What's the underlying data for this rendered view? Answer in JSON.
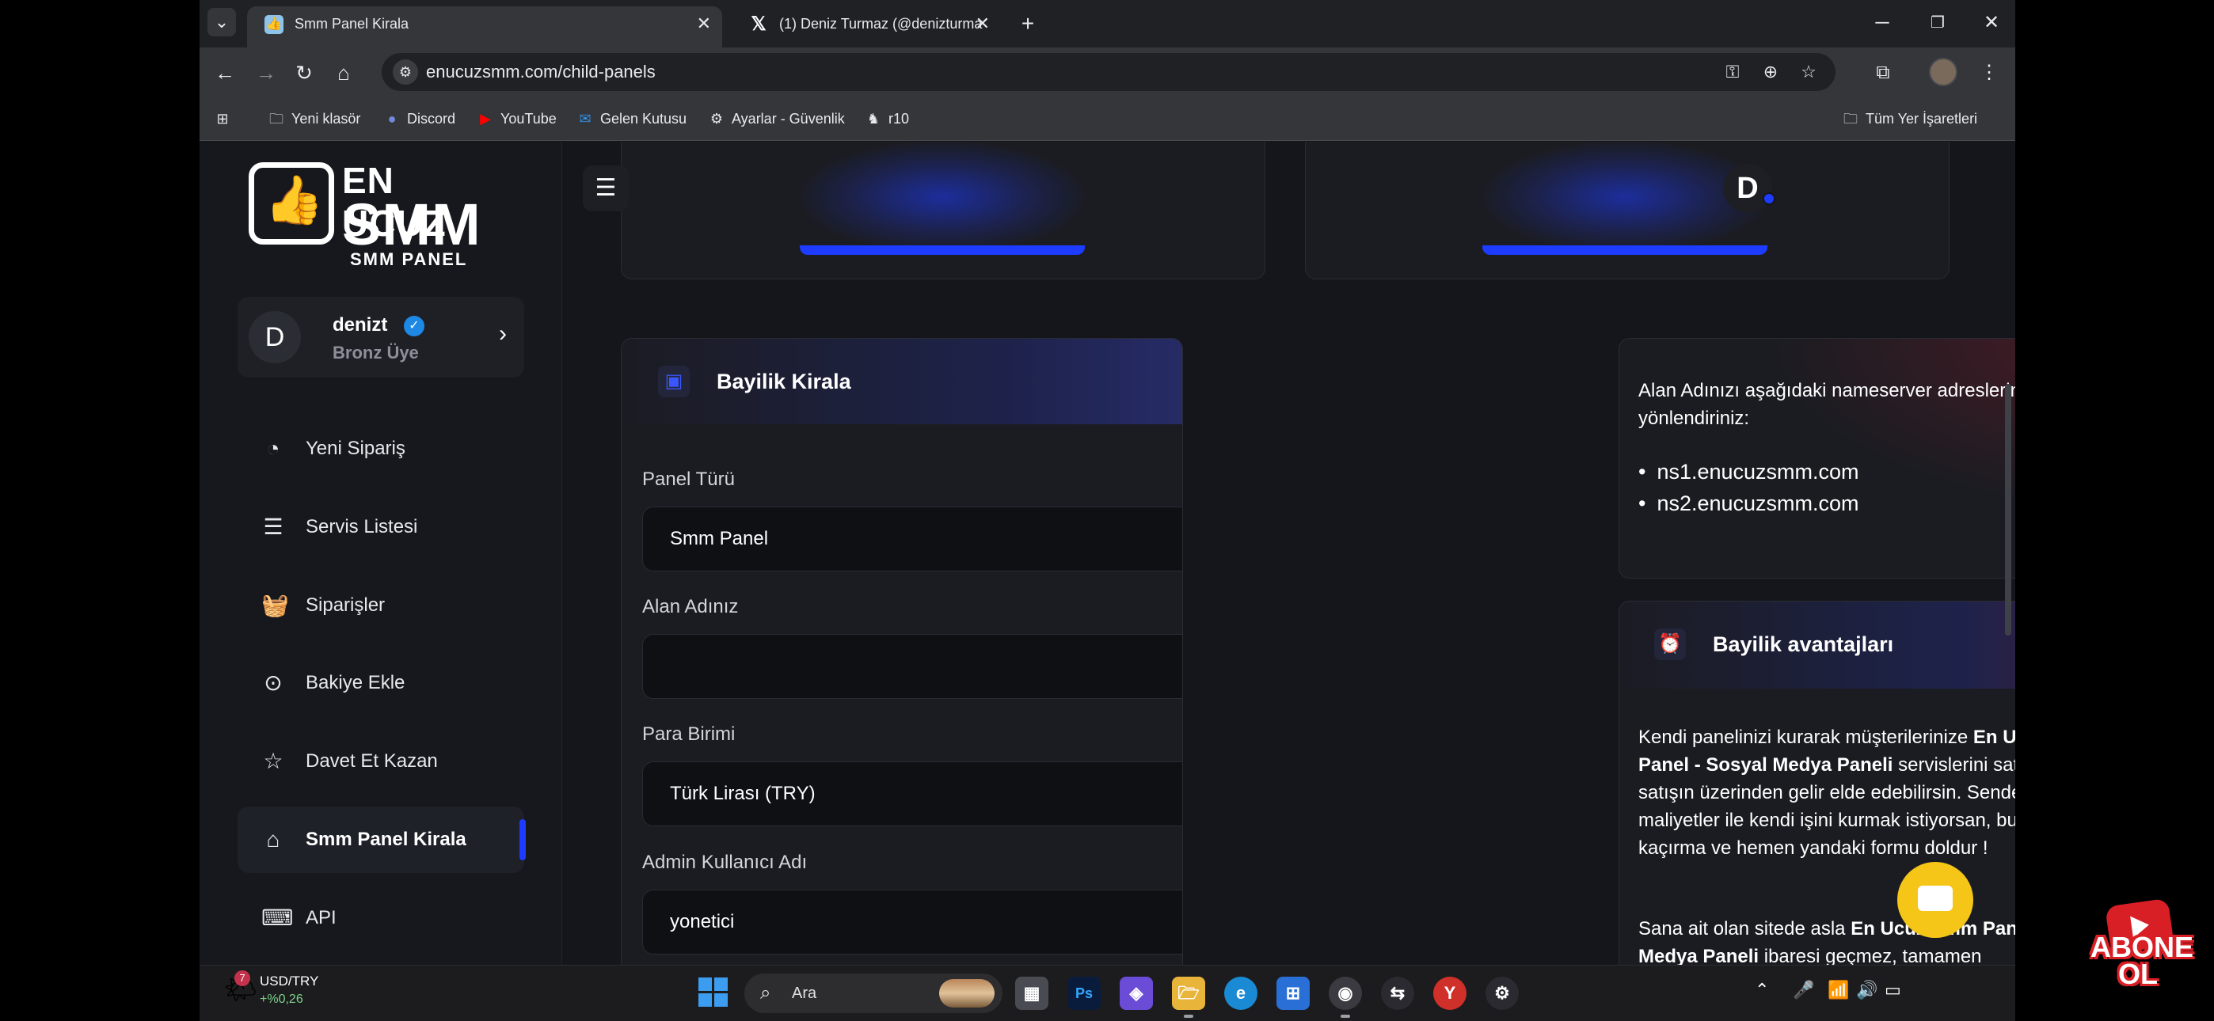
{
  "browser": {
    "tabs": [
      {
        "title": "Smm Panel Kirala",
        "favicon": "smm-favicon",
        "active": true
      },
      {
        "title": "(1) Deniz Turmaz (@denizturma",
        "favicon": "x-logo",
        "active": false
      }
    ],
    "url": "enucuzsmm.com/child-panels",
    "bookmarks": [
      {
        "label": "Yeni klasör",
        "icon": "folder-icon"
      },
      {
        "label": "Discord",
        "icon": "discord-icon"
      },
      {
        "label": "YouTube",
        "icon": "youtube-icon"
      },
      {
        "label": "Gelen Kutusu",
        "icon": "mail-icon"
      },
      {
        "label": "Ayarlar - Güvenlik",
        "icon": "gear-icon"
      },
      {
        "label": "r10",
        "icon": "r10-icon"
      }
    ],
    "all_bookmarks_label": "Tüm Yer İşaretleri"
  },
  "sidebar": {
    "logo": {
      "line1": "EN UCUZ",
      "line2": "SMM",
      "line3": "SMM PANEL"
    },
    "user": {
      "initial": "D",
      "name": "denizt",
      "rank": "Bronz Üye"
    },
    "items": [
      {
        "label": "Yeni Sipariş",
        "icon": "gauge-icon"
      },
      {
        "label": "Servis Listesi",
        "icon": "list-icon"
      },
      {
        "label": "Siparişler",
        "icon": "basket-icon"
      },
      {
        "label": "Bakiye Ekle",
        "icon": "money-icon"
      },
      {
        "label": "Davet Et Kazan",
        "icon": "star-icon"
      },
      {
        "label": "Smm Panel Kirala",
        "icon": "store-icon",
        "active": true
      },
      {
        "label": "API",
        "icon": "terminal-icon"
      }
    ]
  },
  "header": {
    "avatar_initial": "D"
  },
  "form": {
    "title": "Bayilik Kirala",
    "panel_type_label": "Panel Türü",
    "panel_type_value": "Smm Panel",
    "domain_label": "Alan Adınız",
    "domain_value": "",
    "currency_label": "Para Birimi",
    "currency_value": "Türk Lirası (TRY)",
    "admin_label": "Admin Kullanıcı Adı",
    "admin_value": "yonetici"
  },
  "nameserver_card": {
    "text": "Alan Adınızı aşağıdaki nameserver adreslerine yönlendiriniz:",
    "ns": [
      "ns1.enucuzsmm.com",
      "ns2.enucuzsmm.com"
    ]
  },
  "advantages_card": {
    "title": "Bayilik avantajları",
    "p1_a": "Kendi panelinizi kurarak müşterilerinize ",
    "p1_b": "En Ucuz Smm Panel - Sosyal Medya Paneli",
    "p1_c": " servislerini satabilir. Bu satışın üzerinden gelir elde edebilirsin. Sende uygun maliyetler ile kendi işini kurmak istiyorsan, bu fırsatı kaçırma ve hemen yandaki formu doldur !",
    "p2_a": "Sana ait olan sitede asla ",
    "p2_b": "En Ucuz Smm Panel - Sosyal Medya Paneli",
    "p2_c": " ibaresi geçmez, tamamen"
  },
  "taskbar": {
    "widget_badge": "7",
    "ticker": "USD/TRY",
    "ticker_change": "+%0,26",
    "search_placeholder": "Ara"
  },
  "overlay": {
    "subscribe_text": "ABONE OL"
  },
  "colors": {
    "accent": "#1d3cff",
    "chat": "#f5c518",
    "subscribe": "#d91f26"
  }
}
